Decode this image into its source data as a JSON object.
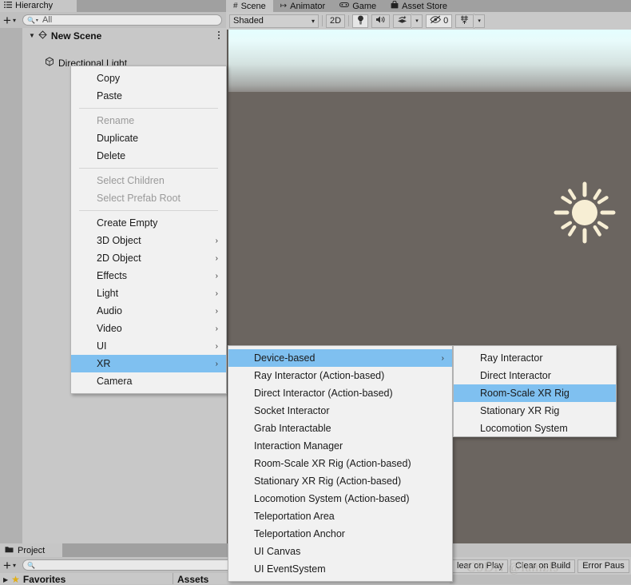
{
  "hierarchy": {
    "tab_label": "Hierarchy",
    "tab_icon": "hierarchy-list-icon",
    "lock_icon": "unlocked-padlock-icon",
    "kebab_icon": "more-options-icon",
    "add_label": "+",
    "add_caret": "▾",
    "search_icon": "search-icon",
    "search_caret": "▾",
    "search_placeholder": "All",
    "search_value": "",
    "rows": [
      {
        "label": "New Scene",
        "icon": "scene-icon",
        "fold": "▼",
        "kebab": "more-options-icon"
      },
      {
        "label": "Directional Light",
        "icon": "gameobject-cube-icon"
      }
    ]
  },
  "scene": {
    "tabs": [
      {
        "label": "Scene",
        "icon": "grid-hash-icon",
        "active": true
      },
      {
        "label": "Animator",
        "icon": "animator-node-icon",
        "active": false
      },
      {
        "label": "Game",
        "icon": "gamepad-icon",
        "active": false
      },
      {
        "label": "Asset Store",
        "icon": "store-bag-icon",
        "active": false
      }
    ],
    "toolbar": {
      "draw_mode": "Shaded",
      "draw_mode_caret": "▾",
      "mode_2d": "2D",
      "lighting_icon": "lightbulb-icon",
      "audio_icon": "speaker-icon",
      "fx_icon": "effects-layers-icon",
      "fx_caret": "▾",
      "visibility_icon": "eye-off-icon",
      "visibility_count": "0",
      "gizmos_icon": "gizmos-icon",
      "gizmos_caret": "▾"
    },
    "viewport": {
      "sky_top_color": "#e4feff",
      "sky_bottom_color": "#8d8b88",
      "ground_color": "#6b6560",
      "light_gizmo": "directional-light-sun-gizmo"
    }
  },
  "project": {
    "tab_label": "Project",
    "tab_icon": "folder-icon",
    "add_label": "+",
    "add_caret": "▾",
    "search_icon": "search-icon",
    "search_value": "",
    "favorites_label": "Favorites",
    "favorites_fold": "▶",
    "favorites_icon": "star-icon",
    "assets_label": "Assets"
  },
  "console_bar": {
    "clear_on_play": "lear on Play",
    "clear_on_build": "Clear on Build",
    "error_pause": "Error Paus"
  },
  "watermark": "CSDN @lamzls",
  "context_menu": {
    "items": [
      {
        "label": "Copy",
        "type": "item",
        "disabled": false
      },
      {
        "label": "Paste",
        "type": "item",
        "disabled": false
      },
      {
        "type": "separator"
      },
      {
        "label": "Rename",
        "type": "item",
        "disabled": true
      },
      {
        "label": "Duplicate",
        "type": "item",
        "disabled": false
      },
      {
        "label": "Delete",
        "type": "item",
        "disabled": false
      },
      {
        "type": "separator"
      },
      {
        "label": "Select Children",
        "type": "item",
        "disabled": true
      },
      {
        "label": "Select Prefab Root",
        "type": "item",
        "disabled": true
      },
      {
        "type": "separator"
      },
      {
        "label": "Create Empty",
        "type": "item",
        "disabled": false
      },
      {
        "label": "3D Object",
        "type": "item",
        "submenu": true
      },
      {
        "label": "2D Object",
        "type": "item",
        "submenu": true
      },
      {
        "label": "Effects",
        "type": "item",
        "submenu": true
      },
      {
        "label": "Light",
        "type": "item",
        "submenu": true
      },
      {
        "label": "Audio",
        "type": "item",
        "submenu": true
      },
      {
        "label": "Video",
        "type": "item",
        "submenu": true
      },
      {
        "label": "UI",
        "type": "item",
        "submenu": true
      },
      {
        "label": "XR",
        "type": "item",
        "submenu": true,
        "selected": true
      },
      {
        "label": "Camera",
        "type": "item"
      }
    ]
  },
  "xr_menu": {
    "items": [
      {
        "label": "Device-based",
        "submenu": true,
        "selected": true
      },
      {
        "label": "Ray Interactor (Action-based)"
      },
      {
        "label": "Direct Interactor (Action-based)"
      },
      {
        "label": "Socket Interactor"
      },
      {
        "label": "Grab Interactable"
      },
      {
        "label": "Interaction Manager"
      },
      {
        "label": "Room-Scale XR Rig (Action-based)"
      },
      {
        "label": "Stationary XR Rig (Action-based)"
      },
      {
        "label": "Locomotion System (Action-based)"
      },
      {
        "label": "Teleportation Area"
      },
      {
        "label": "Teleportation Anchor"
      },
      {
        "label": "UI Canvas"
      },
      {
        "label": "UI EventSystem"
      }
    ]
  },
  "device_based_menu": {
    "items": [
      {
        "label": "Ray Interactor"
      },
      {
        "label": "Direct Interactor"
      },
      {
        "label": "Room-Scale XR Rig",
        "selected": true
      },
      {
        "label": "Stationary XR Rig"
      },
      {
        "label": "Locomotion System"
      }
    ]
  },
  "colors": {
    "selection_blue": "#7fc0f0",
    "menu_bg": "#f1f1f1",
    "panel_bg": "#c2c2c2",
    "tabstrip_bg": "#a0a0a0"
  }
}
